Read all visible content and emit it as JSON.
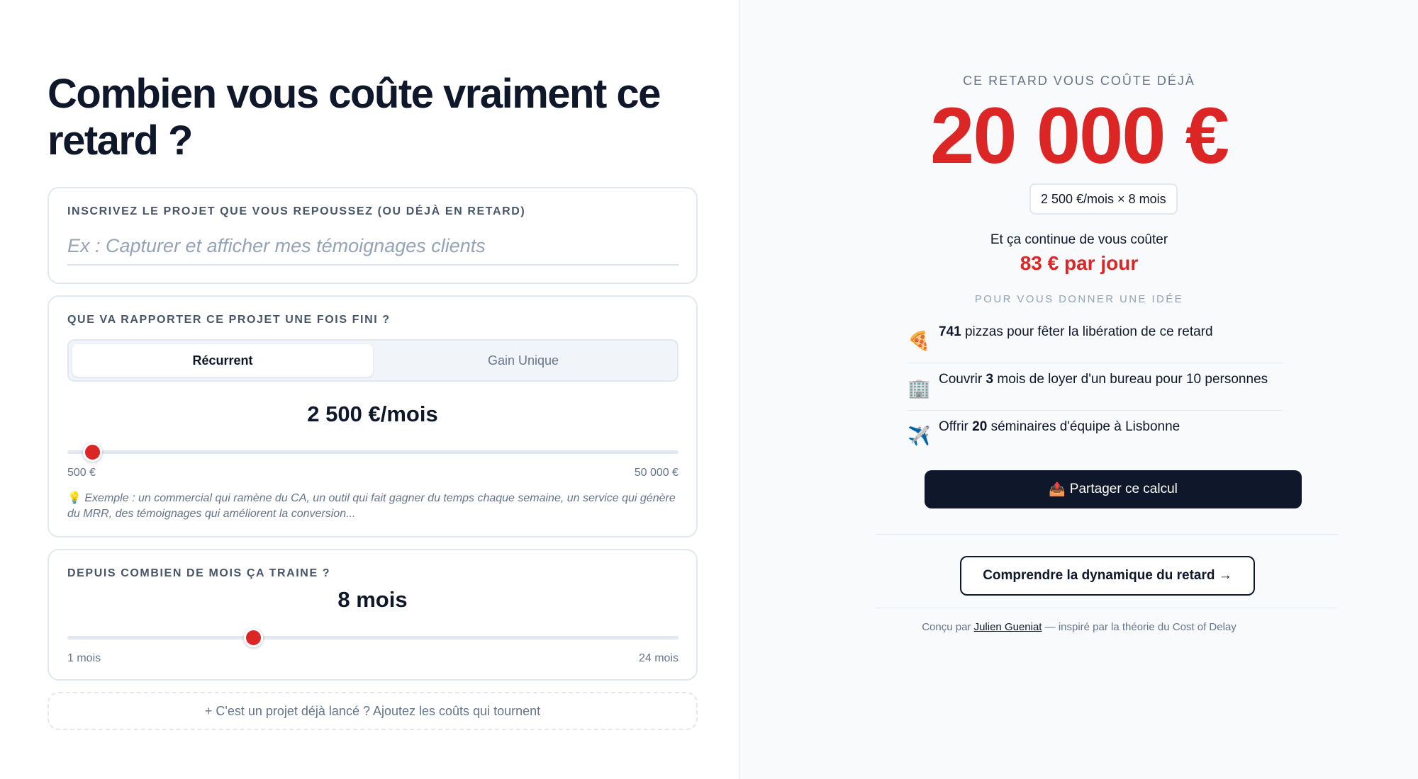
{
  "page": {
    "title": "Combien vous coûte vraiment ce retard ?"
  },
  "project": {
    "label": "INSCRIVEZ LE PROJET QUE VOUS REPOUSSEZ (OU DÉJÀ EN RETARD)",
    "value": "",
    "placeholder": "Ex : Capturer et afficher mes témoignages clients"
  },
  "revenue": {
    "label": "QUE VA RAPPORTER CE PROJET UNE FOIS FINI ?",
    "toggle": {
      "options": [
        "Récurrent",
        "Gain Unique"
      ],
      "selected": "Récurrent"
    },
    "value_display": "2 500 €/mois",
    "slider": {
      "value": 2500,
      "min": 500,
      "max": 50000,
      "min_label": "500 €",
      "max_label": "50 000 €"
    },
    "hint_icon": "lightbulb-icon",
    "hint": "Exemple : un commercial qui ramène du CA, un outil qui fait gagner du temps chaque semaine, un service qui génère du MRR, des témoignages qui améliorent la conversion..."
  },
  "delay": {
    "label": "DEPUIS COMBIEN DE MOIS ÇA TRAINE ?",
    "value_display": "8 mois",
    "slider": {
      "value": 8,
      "min": 1,
      "max": 24,
      "min_label": "1 mois",
      "max_label": "24 mois"
    }
  },
  "add_costs_label": "+ C'est un projet déjà lancé ? Ajoutez les coûts qui tournent",
  "result": {
    "eyebrow": "CE RETARD VOUS COÛTE DÉJÀ",
    "amount": "20 000 €",
    "formula": "2 500 €/mois × 8 mois",
    "continue_text": "Et ça continue de vous coûter",
    "per_day": "83 € par jour",
    "idea_label": "POUR VOUS DONNER UNE IDÉE",
    "items": [
      {
        "icon": "pizza-icon",
        "glyph": "🍕",
        "prefix": "",
        "number": "741",
        "suffix": " pizzas pour fêter la libération de ce retard"
      },
      {
        "icon": "office-building-icon",
        "glyph": "🏢",
        "prefix": "Couvrir ",
        "number": "3",
        "suffix": " mois de loyer d'un bureau pour 10 personnes"
      },
      {
        "icon": "airplane-icon",
        "glyph": "✈️",
        "prefix": "Offrir ",
        "number": "20",
        "suffix": " séminaires d'équipe à Lisbonne"
      }
    ],
    "share_icon": "outbox-tray-icon",
    "share_glyph": "📤",
    "share_label": "Partager ce calcul",
    "learn_label": "Comprendre la dynamique du retard →",
    "credit_prefix": "Conçu par ",
    "credit_author": "Julien Gueniat",
    "credit_suffix": " — inspiré par la théorie du Cost of Delay"
  },
  "colors": {
    "accent_red": "#dc2626",
    "dark": "#0f172a",
    "muted": "#64748b",
    "panel_bg": "#f8fafc",
    "border": "#e2e8f0"
  }
}
